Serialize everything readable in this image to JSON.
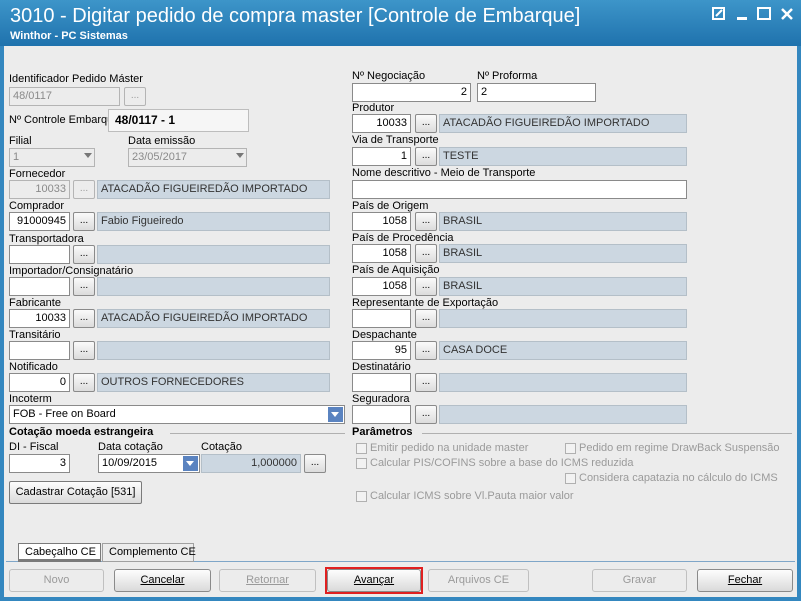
{
  "window": {
    "title": "3010 - Digitar pedido de compra master [Controle de Embarque]",
    "subtitle": "Winthor - PC Sistemas"
  },
  "labels": {
    "id_pedido": "Identificador Pedido Máster",
    "controle": "Nº Controle Embarque:",
    "filial": "Filial",
    "data_emissao": "Data emissão",
    "fornecedor": "Fornecedor",
    "comprador": "Comprador",
    "transportadora": "Transportadora",
    "importador": "Importador/Consignatário",
    "fabricante": "Fabricante",
    "transitario": "Transitário",
    "notificado": "Notificado",
    "incoterm": "Incoterm",
    "negociacao": "Nº Negociação",
    "proforma": "Nº Proforma",
    "produtor": "Produtor",
    "via_transporte": "Via de Transporte",
    "nome_meio": "Nome descritivo - Meio de Transporte",
    "pais_origem": "País de Origem",
    "pais_procedencia": "País de Procedência",
    "pais_aquisicao": "País de Aquisição",
    "representante": "Representante de Exportação",
    "despachante": "Despachante",
    "destinatario": "Destinatário",
    "seguradora": "Seguradora",
    "di_fiscal": "DI - Fiscal",
    "data_cotacao": "Data cotação",
    "cotacao": "Cotação"
  },
  "values": {
    "id_pedido": "48/0117",
    "controle": "48/0117 - 1",
    "filial": "1",
    "data_emissao": "23/05/2017",
    "fornecedor_code": "10033",
    "fornecedor_name": "ATACADÃO FIGUEIREDÃO IMPORTADO",
    "comprador_code": "91000945",
    "comprador_name": "Fabio Figueiredo",
    "fabricante_code": "10033",
    "fabricante_name": "ATACADÃO FIGUEIREDÃO IMPORTADO",
    "notificado_code": "0",
    "notificado_name": "OUTROS FORNECEDORES",
    "incoterm": "FOB - Free on Board",
    "negociacao": "2",
    "proforma": "2",
    "produtor_code": "10033",
    "produtor_name": "ATACADÃO FIGUEIREDÃO IMPORTADO",
    "via_code": "1",
    "via_name": "TESTE",
    "origem_code": "1058",
    "origem_name": "BRASIL",
    "procedencia_code": "1058",
    "procedencia_name": "BRASIL",
    "aquisicao_code": "1058",
    "aquisicao_name": "BRASIL",
    "despachante_code": "95",
    "despachante_name": "CASA DOCE",
    "di_fiscal": "3",
    "data_cotacao": "10/09/2015",
    "cotacao": "1,000000"
  },
  "sections": {
    "cotacao": "Cotação moeda estrangeira",
    "parametros": "Parâmetros"
  },
  "ellipsis": "...",
  "cadastrar_label": "Cadastrar Cotação [531]",
  "checkboxes": {
    "emitir": "Emitir pedido na unidade master",
    "drawback": "Pedido em regime DrawBack Suspensão",
    "piscofins": "Calcular PIS/COFINS sobre a base do ICMS reduzida",
    "capatazia": "Considera capatazia no cálculo do ICMS",
    "icmspauta": "Calcular ICMS sobre Vl.Pauta maior valor"
  },
  "tabs": [
    "Cabeçalho CE",
    "Complemento CE"
  ],
  "buttons": {
    "novo": "Novo",
    "cancelar": "Cancelar",
    "retornar": "Retornar",
    "avancar": "Avançar",
    "arquivos": "Arquivos CE",
    "gravar": "Gravar",
    "fechar": "Fechar"
  },
  "colors": {
    "title_bar": "#2b83be",
    "readonly_field": "#ccd7e1",
    "highlight": "#e02020"
  },
  "icons": {
    "restore": "restore-icon",
    "minimize": "minimize-icon",
    "maximize": "maximize-icon",
    "close": "close-icon"
  }
}
